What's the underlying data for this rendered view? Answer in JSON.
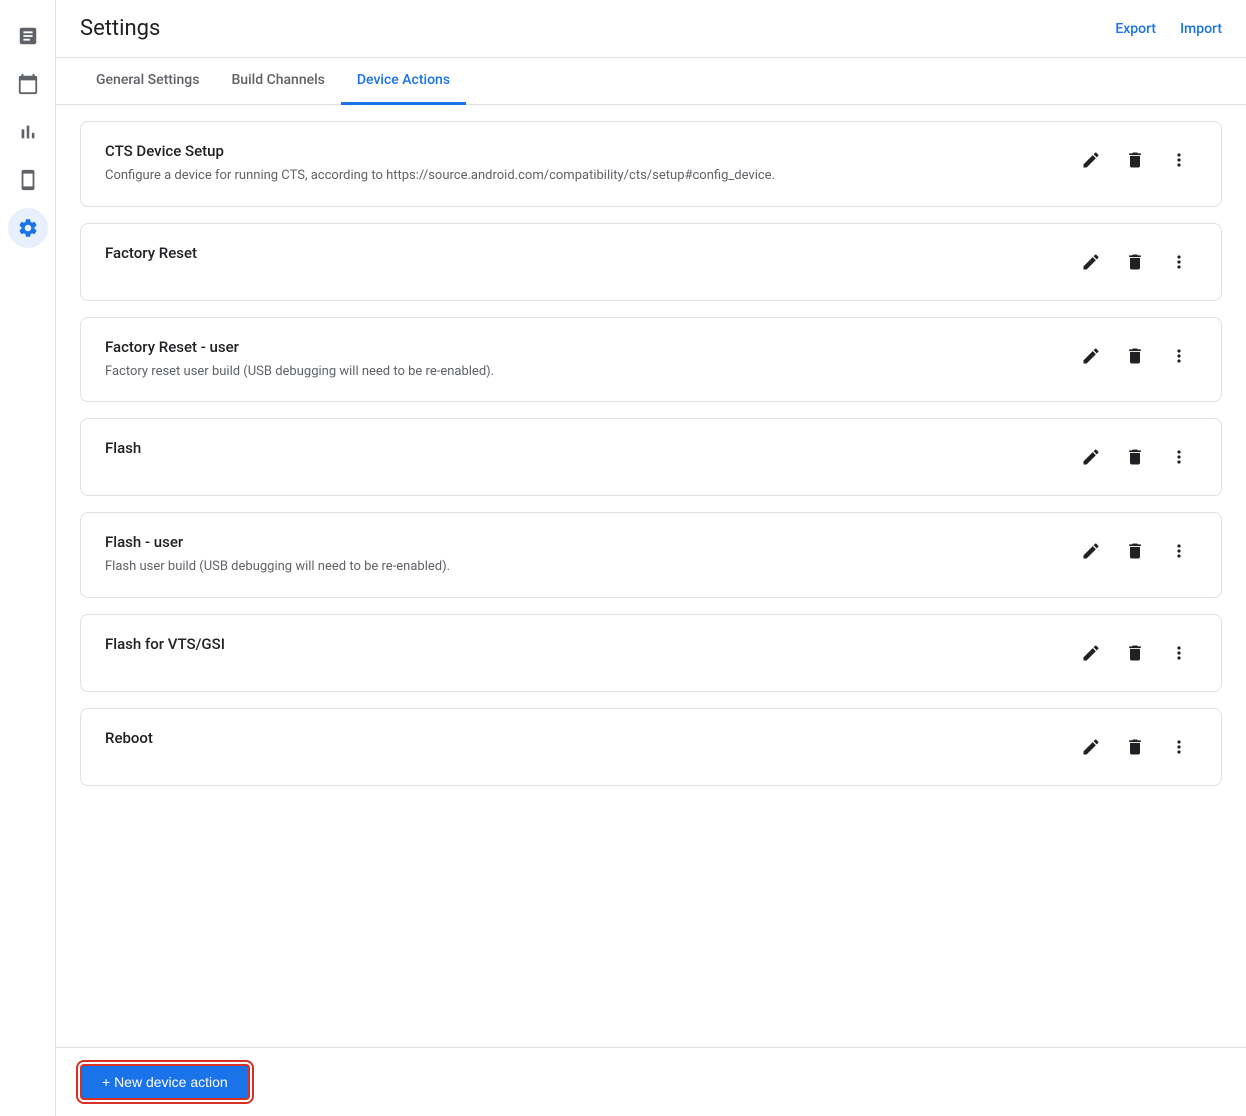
{
  "header": {
    "title": "Settings",
    "export_label": "Export",
    "import_label": "Import"
  },
  "tabs": [
    {
      "id": "general",
      "label": "General Settings",
      "active": false
    },
    {
      "id": "build",
      "label": "Build Channels",
      "active": false
    },
    {
      "id": "device",
      "label": "Device Actions",
      "active": true
    }
  ],
  "sidebar": {
    "items": [
      {
        "id": "reports",
        "icon": "reports",
        "active": false
      },
      {
        "id": "calendar",
        "icon": "calendar",
        "active": false
      },
      {
        "id": "analytics",
        "icon": "analytics",
        "active": false
      },
      {
        "id": "devices",
        "icon": "devices",
        "active": false
      },
      {
        "id": "settings",
        "icon": "settings",
        "active": true
      }
    ]
  },
  "actions": [
    {
      "id": "cts-setup",
      "title": "CTS Device Setup",
      "description": "Configure a device for running CTS, according to https://source.android.com/compatibility/cts/setup#config_device."
    },
    {
      "id": "factory-reset",
      "title": "Factory Reset",
      "description": ""
    },
    {
      "id": "factory-reset-user",
      "title": "Factory Reset - user",
      "description": "Factory reset user build (USB debugging will need to be re-enabled)."
    },
    {
      "id": "flash",
      "title": "Flash",
      "description": ""
    },
    {
      "id": "flash-user",
      "title": "Flash - user",
      "description": "Flash user build (USB debugging will need to be re-enabled)."
    },
    {
      "id": "flash-vts",
      "title": "Flash for VTS/GSI",
      "description": ""
    },
    {
      "id": "reboot",
      "title": "Reboot",
      "description": ""
    }
  ],
  "footer": {
    "new_action_label": "+ New device action"
  }
}
